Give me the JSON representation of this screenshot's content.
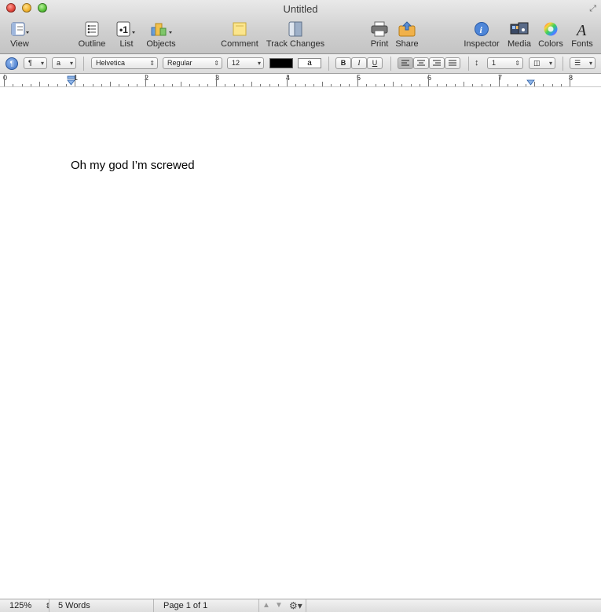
{
  "window": {
    "title": "Untitled"
  },
  "toolbar": {
    "view": "View",
    "outline": "Outline",
    "list": "List",
    "objects": "Objects",
    "comment": "Comment",
    "track_changes": "Track Changes",
    "print": "Print",
    "share": "Share",
    "inspector": "Inspector",
    "media": "Media",
    "colors": "Colors",
    "fonts": "Fonts"
  },
  "format_bar": {
    "paragraph_style_glyph": "¶",
    "character_style_glyph": "a",
    "font_family": "Helvetica",
    "font_style": "Regular",
    "font_size": "12",
    "text_color": "#000000",
    "highlight_glyph": "a",
    "bold": "B",
    "italic": "I",
    "underline": "U",
    "line_spacing": "1"
  },
  "ruler": {
    "numbers": [
      "0",
      "1",
      "2",
      "3",
      "4",
      "5",
      "6",
      "7",
      "8"
    ]
  },
  "document": {
    "text": "Oh my god I’m screwed"
  },
  "status_bar": {
    "zoom": "125%",
    "word_count": "5 Words",
    "page_info": "Page 1 of 1"
  }
}
